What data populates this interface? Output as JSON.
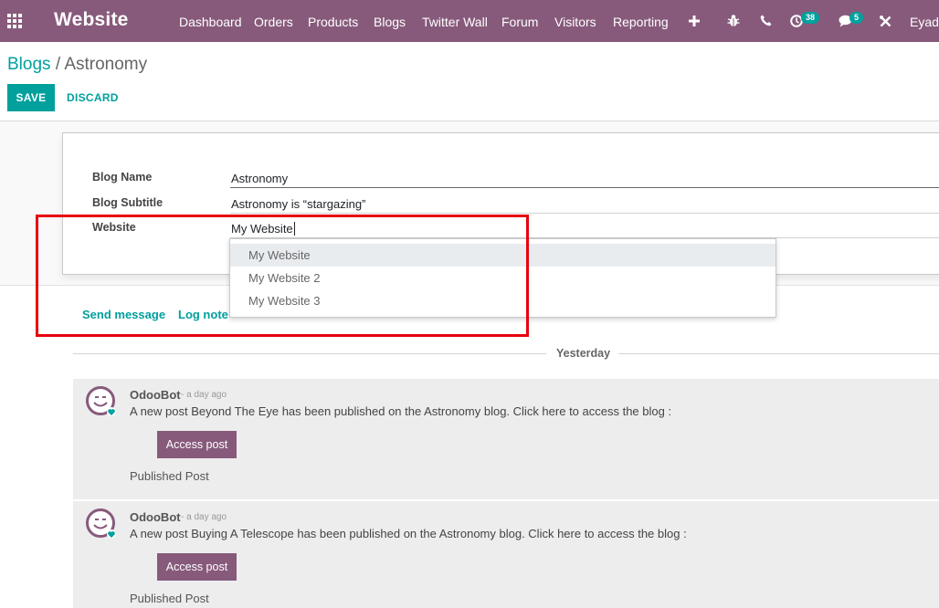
{
  "navbar": {
    "brand": "Website",
    "menu": [
      {
        "label": "Dashboard"
      },
      {
        "label": "Orders"
      },
      {
        "label": "Products"
      },
      {
        "label": "Blogs"
      },
      {
        "label": "Twitter Wall"
      },
      {
        "label": "Forum"
      },
      {
        "label": "Visitors"
      },
      {
        "label": "Reporting"
      }
    ],
    "activity_badge": "38",
    "messages_badge": "5",
    "user": "Eyad"
  },
  "breadcrumb": {
    "parent": "Blogs",
    "separator": "/",
    "current": "Astronomy"
  },
  "control": {
    "save": "SAVE",
    "discard": "DISCARD"
  },
  "form": {
    "blog_name_label": "Blog Name",
    "blog_name_value": "Astronomy",
    "blog_subtitle_label": "Blog Subtitle",
    "blog_subtitle_value": "Astronomy is “stargazing”",
    "website_label": "Website",
    "website_value": "My Website"
  },
  "dropdown": {
    "options": [
      "My Website",
      "My Website 2",
      "My Website 3"
    ],
    "highlighted": "My Website"
  },
  "chatter": {
    "send_message": "Send message",
    "log_note": "Log note",
    "day_separator": "Yesterday",
    "messages": [
      {
        "author": "OdooBot",
        "ago": "- a day ago",
        "text": "A new post Beyond The Eye has been published on the Astronomy blog. Click here to access the blog :",
        "button": "Access post",
        "subtype": "Published Post"
      },
      {
        "author": "OdooBot",
        "ago": "- a day ago",
        "text": "A new post Buying A Telescope has been published on the Astronomy blog. Click here to access the blog :",
        "button": "Access post",
        "subtype": "Published Post"
      }
    ]
  },
  "colors": {
    "brand": "#875a7b",
    "accent": "#00a09d",
    "highlight_border": "#e8000b"
  }
}
